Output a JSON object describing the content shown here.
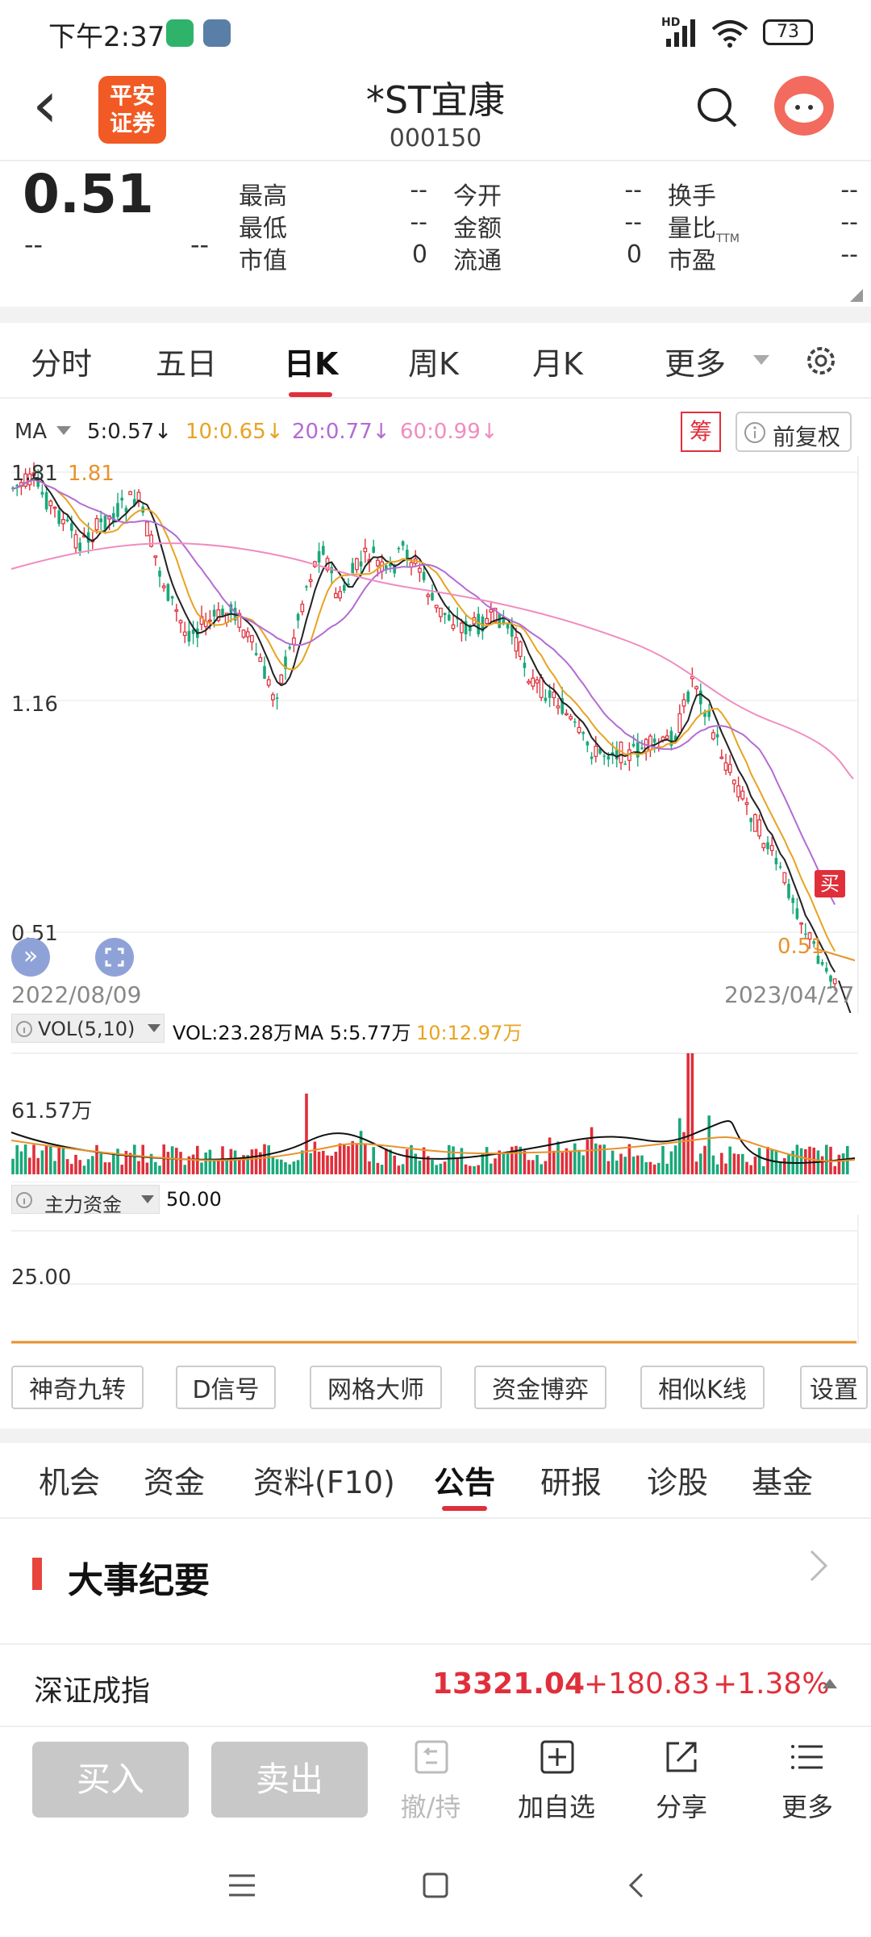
{
  "status": {
    "time": "下午2:37",
    "net": "HD",
    "battery": "73"
  },
  "header": {
    "back": "‹",
    "logo": "平安证券",
    "title": "*ST宜康",
    "code": "000150"
  },
  "quote": {
    "price": "0.51",
    "change": "--",
    "change_pct": "--",
    "fields": [
      {
        "label": "最高",
        "value": "--"
      },
      {
        "label": "今开",
        "value": "--"
      },
      {
        "label": "换手",
        "value": "--"
      },
      {
        "label": "最低",
        "value": "--"
      },
      {
        "label": "金额",
        "value": "--"
      },
      {
        "label": "量比",
        "value": "--"
      },
      {
        "label": "市值",
        "value": "0"
      },
      {
        "label": "流通",
        "value": "0"
      },
      {
        "label": "市盈",
        "value": "--",
        "sup": "TTM"
      }
    ]
  },
  "chart_tabs": {
    "items": [
      "分时",
      "五日",
      "日K",
      "周K",
      "月K"
    ],
    "active": "日K",
    "more": "更多"
  },
  "ma": {
    "label": "MA",
    "ma5": "5:0.57↓",
    "ma10": "10:0.65↓",
    "ma20": "20:0.77↓",
    "ma60": "60:0.99↓",
    "chou": "筹",
    "adjust": "前复权"
  },
  "kline": {
    "y_high": "1.81",
    "y_high_r": "1.81",
    "y_mid": "1.16",
    "y_low": "0.51",
    "y_low_r": "0.51",
    "date_start": "2022/08/09",
    "date_end": "2023/04/27",
    "buy_marker": "买"
  },
  "vol": {
    "label": "VOL(5,10)",
    "vol": "VOL:23.28万",
    "ma5": "MA 5:5.77万",
    "ma10": "10:12.97万",
    "y_max": "61.57万"
  },
  "capital": {
    "label": "主力资金",
    "val": "50.00",
    "y_mid": "25.00"
  },
  "tools": {
    "items": [
      "神奇九转",
      "D信号",
      "网格大师",
      "资金博弈",
      "相似K线",
      "设置"
    ]
  },
  "info_tabs": {
    "items": [
      "机会",
      "资金",
      "资料(F10)",
      "公告",
      "研报",
      "诊股",
      "基金"
    ],
    "active": "公告"
  },
  "section": {
    "title": "大事纪要"
  },
  "index": {
    "name": "深证成指",
    "value": "13321.04",
    "change": "+180.83",
    "pct": "+1.38%"
  },
  "footer": {
    "buy": "买入",
    "sell": "卖出",
    "cancel": "撤/持",
    "add": "加自选",
    "share": "分享",
    "more": "更多"
  },
  "colors": {
    "up": "#e02f3a",
    "down": "#1aa87a",
    "ma5": "#222222",
    "ma10": "#e8a321",
    "ma20": "#b36bd4",
    "ma60": "#f08cc0",
    "orange": "#e8922c",
    "brand": "#f15a24"
  }
}
